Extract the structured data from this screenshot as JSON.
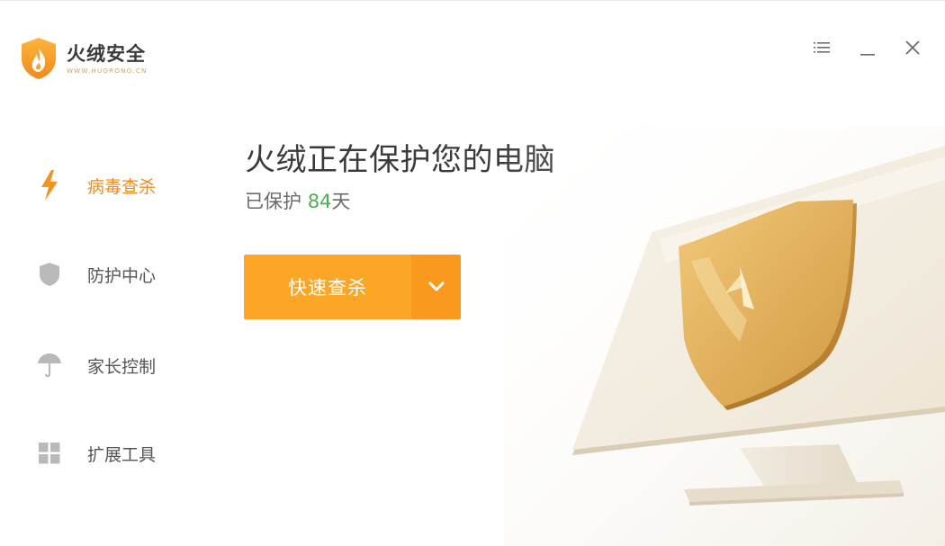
{
  "app": {
    "name": "火绒安全",
    "url": "WWW.HUORONG.CN"
  },
  "window_controls": {
    "menu_icon": "menu-list-icon",
    "minimize_icon": "minimize-icon",
    "close_icon": "close-icon"
  },
  "sidebar": {
    "items": [
      {
        "label": "病毒查杀",
        "icon": "lightning-icon",
        "active": true
      },
      {
        "label": "防护中心",
        "icon": "shield-icon",
        "active": false
      },
      {
        "label": "家长控制",
        "icon": "umbrella-icon",
        "active": false
      },
      {
        "label": "扩展工具",
        "icon": "grid-icon",
        "active": false
      }
    ]
  },
  "main": {
    "headline": "火绒正在保护您的电脑",
    "protected_prefix": "已保护 ",
    "protected_days": "84",
    "protected_suffix": "天",
    "scan_button": "快速查杀",
    "scan_dropdown_icon": "chevron-down-icon"
  },
  "colors": {
    "accent": "#f08a1c",
    "button": "#fca626",
    "button_dropdown": "#f99a1f",
    "days_green": "#4caf50",
    "shield_gold": "#e8b960"
  }
}
